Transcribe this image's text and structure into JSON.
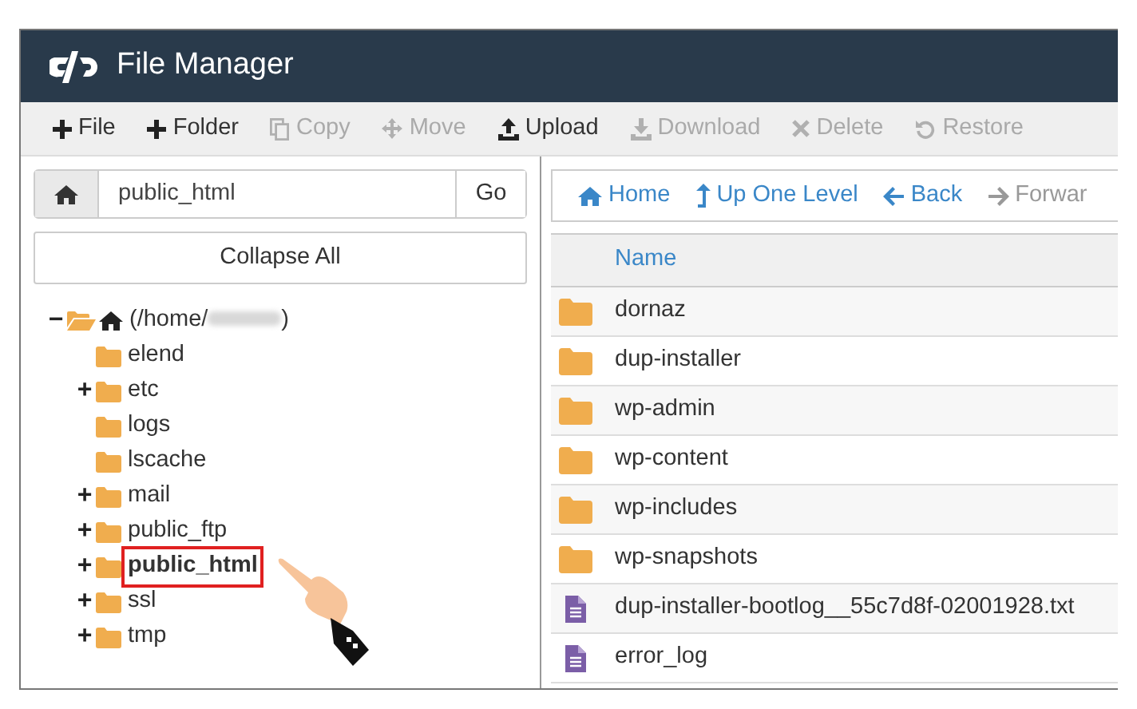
{
  "header": {
    "title": "File Manager"
  },
  "toolbar": [
    {
      "label": "File",
      "disabled": false
    },
    {
      "label": "Folder",
      "disabled": false
    },
    {
      "label": "Copy",
      "disabled": true
    },
    {
      "label": "Move",
      "disabled": true
    },
    {
      "label": "Upload",
      "disabled": false
    },
    {
      "label": "Download",
      "disabled": true
    },
    {
      "label": "Delete",
      "disabled": true
    },
    {
      "label": "Restore",
      "disabled": true
    }
  ],
  "path_bar": {
    "value": "public_html",
    "button": "Go"
  },
  "collapse_button": "Collapse All",
  "tree": [
    {
      "toggle": "−",
      "label": "(/home/",
      "suffix": ")",
      "kind": "home",
      "expanded": true,
      "selected": false,
      "highlighted": false,
      "children": [
        {
          "label": "elend",
          "kind": "folder",
          "selected": false,
          "highlighted": false
        },
        {
          "toggle": "+",
          "label": "etc",
          "kind": "folder",
          "selected": false,
          "highlighted": false
        },
        {
          "label": "logs",
          "kind": "folder",
          "selected": false,
          "highlighted": false
        },
        {
          "label": "lscache",
          "kind": "folder",
          "selected": false,
          "highlighted": false
        },
        {
          "toggle": "+",
          "label": "mail",
          "kind": "folder",
          "selected": false,
          "highlighted": false
        },
        {
          "toggle": "+",
          "label": "public_ftp",
          "kind": "folder",
          "selected": false,
          "highlighted": false
        },
        {
          "toggle": "+",
          "label": "public_html",
          "kind": "folder",
          "selected": true,
          "highlighted": true
        },
        {
          "toggle": "+",
          "label": "ssl",
          "kind": "folder",
          "selected": false,
          "highlighted": false
        },
        {
          "toggle": "+",
          "label": "tmp",
          "kind": "folder",
          "selected": false,
          "highlighted": false
        }
      ]
    }
  ],
  "nav": [
    {
      "label": "Home",
      "disabled": false
    },
    {
      "label": "Up One Level",
      "disabled": false
    },
    {
      "label": "Back",
      "disabled": false
    },
    {
      "label": "Forwar",
      "disabled": true
    }
  ],
  "table": {
    "columns": [
      "Name"
    ],
    "rows": [
      {
        "name": "dornaz",
        "kind": "folder"
      },
      {
        "name": "dup-installer",
        "kind": "folder"
      },
      {
        "name": "wp-admin",
        "kind": "folder"
      },
      {
        "name": "wp-content",
        "kind": "folder"
      },
      {
        "name": "wp-includes",
        "kind": "folder"
      },
      {
        "name": "wp-snapshots",
        "kind": "folder"
      },
      {
        "name": "dup-installer-bootlog__55c7d8f-02001928.txt",
        "kind": "file"
      },
      {
        "name": "error_log",
        "kind": "file"
      }
    ]
  }
}
